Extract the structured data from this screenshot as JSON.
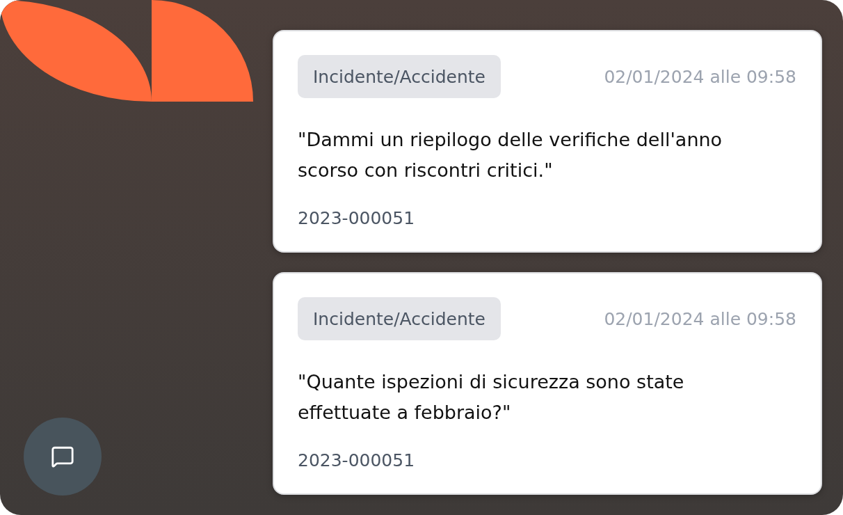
{
  "cards": [
    {
      "category": "Incidente/Accidente",
      "timestamp": "02/01/2024 alle 09:58",
      "question": "\"Dammi un riepilogo delle verifiche dell'anno scorso con riscontri critici.\"",
      "reference": "2023-000051"
    },
    {
      "category": "Incidente/Accidente",
      "timestamp": "02/01/2024 alle 09:58",
      "question": "\"Quante ispezioni di sicurezza sono state effettuate a febbraio?\"",
      "reference": "2023-000051"
    }
  ]
}
